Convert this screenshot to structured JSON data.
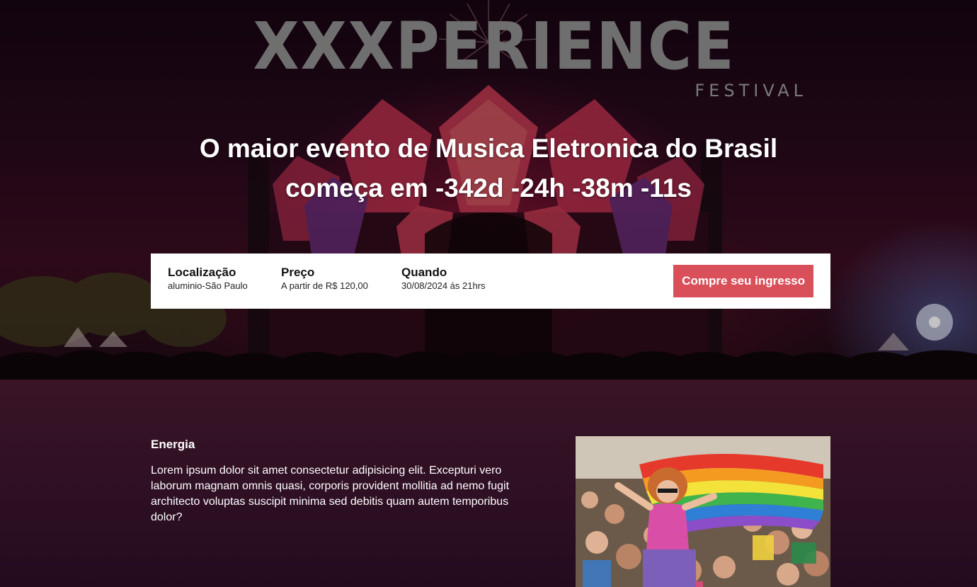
{
  "hero": {
    "logo": {
      "wordmark": "XXXPERIENCE",
      "subtitle": "FESTIVAL"
    },
    "headline": {
      "line1": "O maior evento de Musica Eletronica do Brasil",
      "line2": "começa em -342d -24h -38m -11s"
    },
    "info": {
      "location": {
        "title": "Localização",
        "value": "aluminio-São Paulo"
      },
      "price": {
        "title": "Preço",
        "value": "A partir de R$ 120,00"
      },
      "when": {
        "title": "Quando",
        "value": "30/08/2024 ás 21hrs"
      },
      "buy_label": "Compre seu ingresso"
    }
  },
  "energy": {
    "title": "Energia",
    "text": "Lorem ipsum dolor sit amet consectetur adipisicing elit. Excepturi vero laborum magnam omnis quasi, corporis provident mollitia ad nemo fugit architecto voluptas suscipit minima sed debitis quam autem temporibus dolor?"
  },
  "colors": {
    "accent": "#d9505a",
    "section_bg": "#2e0f24",
    "info_bar_bg": "#ffffff"
  }
}
